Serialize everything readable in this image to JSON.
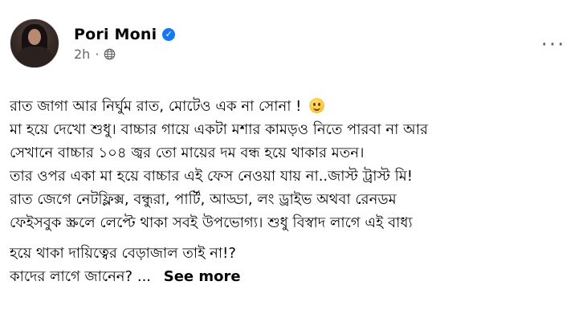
{
  "author": {
    "name": "Pori Moni",
    "verified_badge_icon": "verified-check-icon",
    "timestamp": "2h",
    "separator": "·",
    "privacy_icon": "globe-icon"
  },
  "menu": {
    "more_label": "···",
    "icon": "more-options-icon"
  },
  "post": {
    "lines": [
      "রাত জাগা আর নির্ঘুম রাত, মোটেও এক না সোনা !",
      "মা হয়ে দেখো শুধু। বাচ্চার গায়ে একটা মশার কামড়ও নিতে পারবা না আর",
      "সেখানে বাচ্চার ১০৪ জ্বর তো মায়ের দম বন্ধ হয়ে থাকার মতন।",
      "তার ওপর একা মা হয়ে বাচ্চার এই ফেস নেওয়া যায় না..জাস্ট ট্রাস্ট মি!",
      "রাত জেগে নেটফ্লিক্স, বন্ধুরা, পার্টি, আড্ডা, লং ড্রাইভ অথবা রেনডম",
      "ফেইসবুক স্ক্রলে লেপ্টে থাকা সবই উপভোগ্য। শুধু বিস্বাদ লাগে এই বাধ্য",
      "হয়ে থাকা দায়িত্বের বেড়াজাল তাই না!?",
      "কাদের লাগে জানেন?"
    ],
    "emoji_icon": "smiling-face-emoji-icon",
    "ellipsis": "...",
    "see_more": "See more"
  }
}
